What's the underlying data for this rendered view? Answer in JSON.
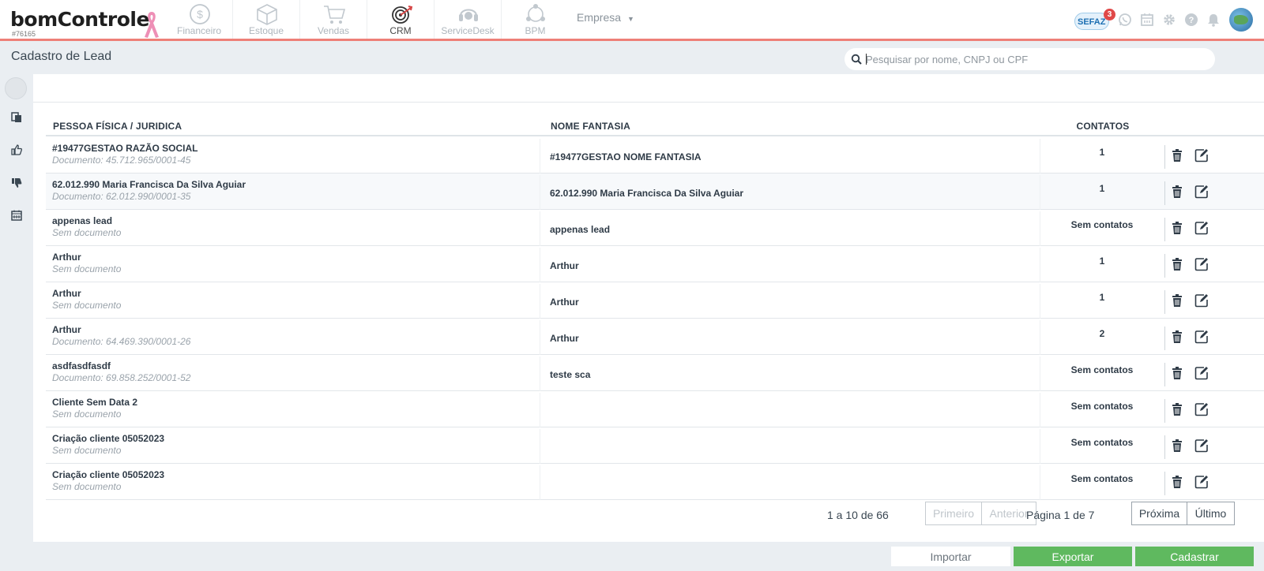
{
  "brand": {
    "name": "bomControle",
    "account_id": "#76165"
  },
  "modules": [
    {
      "label": "Financeiro",
      "icon": "dollar-coin-icon",
      "active": false
    },
    {
      "label": "Estoque",
      "icon": "box-icon",
      "active": false
    },
    {
      "label": "Vendas",
      "icon": "cart-icon",
      "active": false
    },
    {
      "label": "CRM",
      "icon": "target-icon",
      "active": true
    },
    {
      "label": "ServiceDesk",
      "icon": "headset-icon",
      "active": false
    },
    {
      "label": "BPM",
      "icon": "process-network-icon",
      "active": false
    }
  ],
  "empresa_label": "Empresa",
  "sefaz": {
    "label": "SEFAZ",
    "badge": "3"
  },
  "page": {
    "title": "Cadastro de Lead",
    "search_placeholder": "Pesquisar por nome, CNPJ ou CPF"
  },
  "table": {
    "headers": {
      "pessoa": "PESSOA FÍSICA / JURIDICA",
      "fantasia": "NOME FANTASIA",
      "contatos": "CONTATOS"
    },
    "rows": [
      {
        "name": "#19477GESTAO RAZÃO SOCIAL",
        "doc": "Documento: 45.712.965/0001-45",
        "fantasia": "#19477GESTAO NOME FANTASIA",
        "contatos": "1"
      },
      {
        "name": "62.012.990 Maria Francisca Da Silva Aguiar",
        "doc": "Documento: 62.012.990/0001-35",
        "fantasia": "62.012.990 Maria Francisca Da Silva Aguiar",
        "contatos": "1"
      },
      {
        "name": "appenas lead",
        "doc": "Sem documento",
        "fantasia": "appenas lead",
        "contatos": "Sem contatos"
      },
      {
        "name": "Arthur",
        "doc": "Sem documento",
        "fantasia": "Arthur",
        "contatos": "1"
      },
      {
        "name": "Arthur",
        "doc": "Sem documento",
        "fantasia": "Arthur",
        "contatos": "1"
      },
      {
        "name": "Arthur",
        "doc": "Documento: 64.469.390/0001-26",
        "fantasia": "Arthur",
        "contatos": "2"
      },
      {
        "name": "asdfasdfasdf",
        "doc": "Documento: 69.858.252/0001-52",
        "fantasia": "teste sca",
        "contatos": "Sem contatos"
      },
      {
        "name": "Cliente Sem Data 2",
        "doc": "Sem documento",
        "fantasia": "",
        "contatos": "Sem contatos"
      },
      {
        "name": "Criação cliente 05052023",
        "doc": "Sem documento",
        "fantasia": "",
        "contatos": "Sem contatos"
      },
      {
        "name": "Criação cliente 05052023",
        "doc": "Sem documento",
        "fantasia": "",
        "contatos": "Sem contatos"
      }
    ]
  },
  "pagination": {
    "range": "1 a 10 de 66",
    "first": "Primeiro",
    "prev": "Anterior",
    "page_label": "Página 1 de 7",
    "next": "Próxima",
    "last": "Último"
  },
  "actions": {
    "import": "Importar",
    "export": "Exportar",
    "create": "Cadastrar"
  },
  "colors": {
    "accent_line": "#ee7f78",
    "primary_green": "#5fb95f",
    "badge_red": "#e04848"
  }
}
